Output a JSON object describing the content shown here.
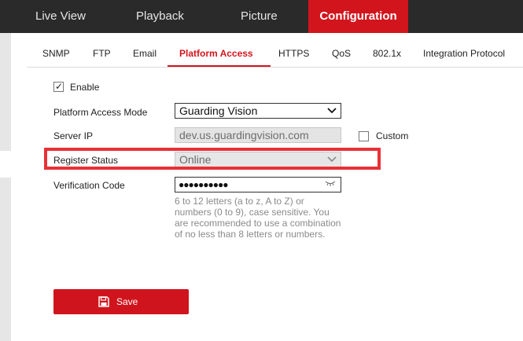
{
  "topnav": {
    "items": [
      {
        "label": "Live View"
      },
      {
        "label": "Playback"
      },
      {
        "label": "Picture"
      },
      {
        "label": "Configuration"
      }
    ]
  },
  "subtabs": [
    {
      "label": "SNMP"
    },
    {
      "label": "FTP"
    },
    {
      "label": "Email"
    },
    {
      "label": "Platform Access"
    },
    {
      "label": "HTTPS"
    },
    {
      "label": "QoS"
    },
    {
      "label": "802.1x"
    },
    {
      "label": "Integration Protocol"
    }
  ],
  "form": {
    "enable": {
      "label": "Enable",
      "checked": true
    },
    "platform_access_mode": {
      "label": "Platform Access Mode",
      "value": "Guarding Vision"
    },
    "server_ip": {
      "label": "Server IP",
      "value": "dev.us.guardingvision.com"
    },
    "custom": {
      "label": "Custom",
      "checked": false
    },
    "register_status": {
      "label": "Register Status",
      "value": "Online"
    },
    "verification_code": {
      "label": "Verification Code",
      "value": "●●●●●●●●●●",
      "hint": "6 to 12 letters (a to z, A to Z) or numbers (0 to 9), case sensitive. You are recommended to use a combination of no less than 8 letters or numbers."
    }
  },
  "save_button": {
    "label": "Save"
  },
  "colors": {
    "accent": "#d2151d",
    "highlight": "#e83136",
    "nav_background": "#2a2a2a"
  },
  "icons": {
    "eye": "eye-closed-icon",
    "save": "floppy-disk-icon",
    "dropdown": "chevron-down-icon",
    "check": "check-icon"
  }
}
